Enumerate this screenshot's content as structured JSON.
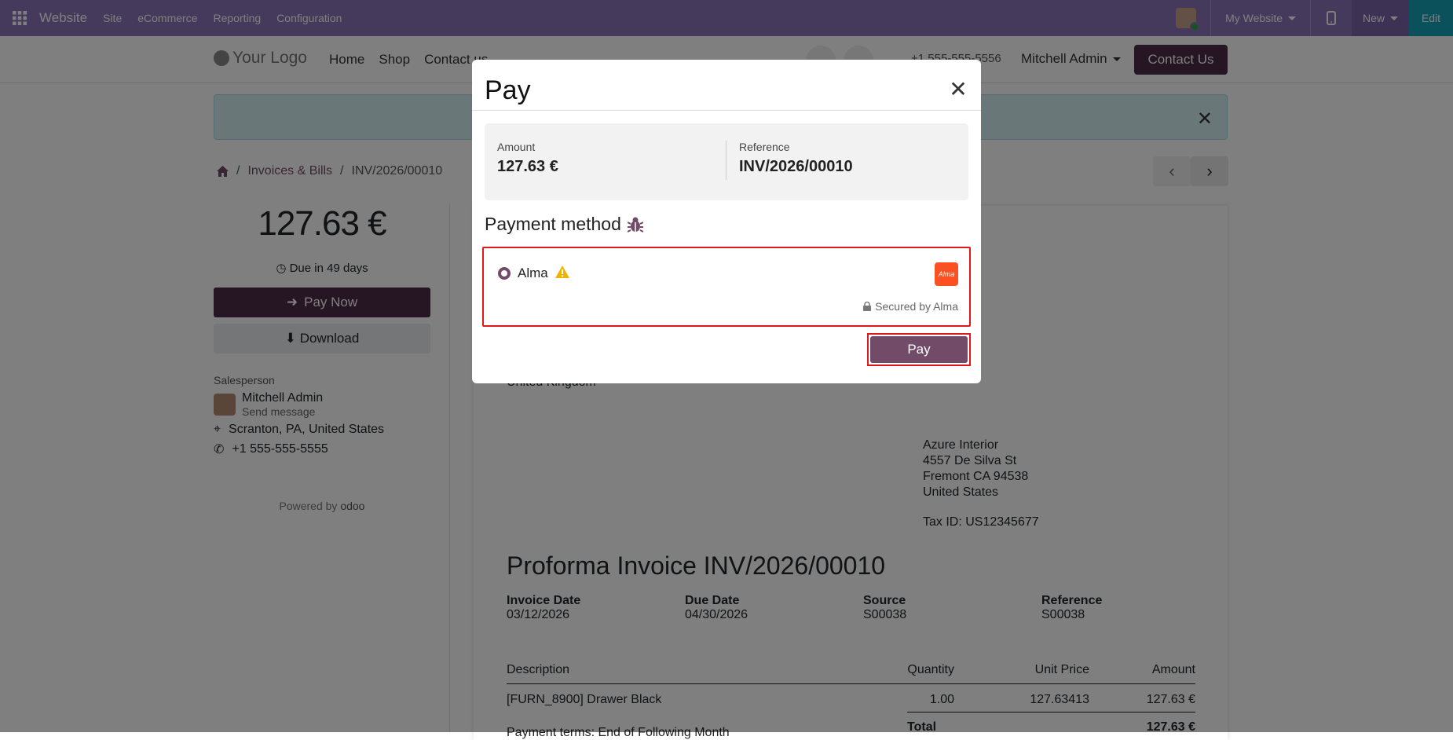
{
  "topbar": {
    "brand": "Website",
    "menus": [
      "Site",
      "eCommerce",
      "Reporting",
      "Configuration"
    ],
    "my_website": "My Website",
    "new_label": "New",
    "edit_label": "Edit",
    "color": "#8b74b9"
  },
  "header": {
    "logo": "Your Logo",
    "nav": [
      "Home",
      "Shop",
      "Contact us"
    ],
    "phone": "+1 555-555-5556",
    "user": "Mitchell Admin",
    "contact_button": "Contact Us"
  },
  "breadcrumb": {
    "items": [
      "Invoices & Bills",
      "INV/2026/00010"
    ]
  },
  "left": {
    "amount": "127.63 €",
    "due": "Due in 49 days",
    "pay_now": "Pay Now",
    "download": "Download",
    "salesperson_label": "Salesperson",
    "salesperson_name": "Mitchell Admin",
    "send_message": "Send message",
    "location": "Scranton, PA, United States",
    "phone": "+1 555-555-5555",
    "powered_by": "Powered by",
    "odoo": "odoo"
  },
  "invoice": {
    "partial_country": "United Kingdom",
    "customer": {
      "name": "Azure Interior",
      "street": "4557 De Silva St",
      "city": "Fremont CA 94538",
      "country": "United States",
      "tax_id": "Tax ID: US12345677"
    },
    "title": "Proforma Invoice INV/2026/00010",
    "meta": [
      {
        "label": "Invoice Date",
        "value": "03/12/2026"
      },
      {
        "label": "Due Date",
        "value": "04/30/2026"
      },
      {
        "label": "Source",
        "value": "S00038"
      },
      {
        "label": "Reference",
        "value": "S00038"
      }
    ],
    "columns": [
      "Description",
      "Quantity",
      "Unit Price",
      "Amount"
    ],
    "lines": [
      {
        "description": "[FURN_8900] Drawer Black",
        "quantity": "1.00",
        "unit_price": "127.63413",
        "amount": "127.63 €"
      }
    ],
    "total_label": "Total",
    "total_value": "127.63 €",
    "terms_partial": "Payment terms: End of Following Month"
  },
  "modal": {
    "title": "Pay",
    "amount_label": "Amount",
    "amount_value": "127.63 €",
    "reference_label": "Reference",
    "reference_value": "INV/2026/00010",
    "payment_method_title": "Payment method",
    "method_name": "Alma",
    "method_logo_text": "Alma",
    "secured_text": "Secured by Alma",
    "pay_button": "Pay"
  }
}
